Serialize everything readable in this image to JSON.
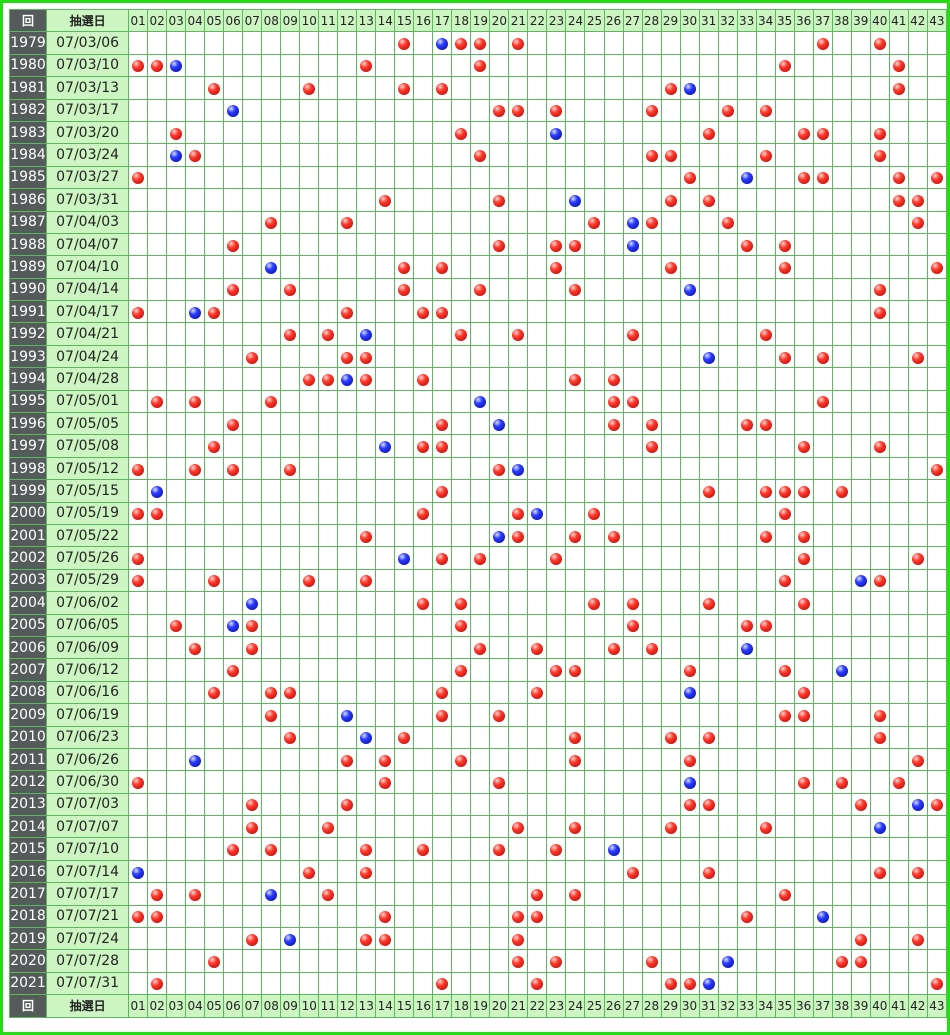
{
  "header": {
    "kai_label": "回",
    "date_label": "抽選日"
  },
  "footer": {
    "kai_label": "回",
    "date_label": "抽選日"
  },
  "numbers": [
    "01",
    "02",
    "03",
    "04",
    "05",
    "06",
    "07",
    "08",
    "09",
    "10",
    "11",
    "12",
    "13",
    "14",
    "15",
    "16",
    "17",
    "18",
    "19",
    "20",
    "21",
    "22",
    "23",
    "24",
    "25",
    "26",
    "27",
    "28",
    "29",
    "30",
    "31",
    "32",
    "33",
    "34",
    "35",
    "36",
    "37",
    "38",
    "39",
    "40",
    "41",
    "42",
    "43"
  ],
  "draws": [
    {
      "kai": "1979",
      "date": "07/03/06",
      "main": [
        15,
        18,
        19,
        21,
        37,
        40
      ],
      "bonus": 17
    },
    {
      "kai": "1980",
      "date": "07/03/10",
      "main": [
        1,
        2,
        13,
        19,
        35,
        41
      ],
      "bonus": 3
    },
    {
      "kai": "1981",
      "date": "07/03/13",
      "main": [
        5,
        10,
        15,
        17,
        29,
        41
      ],
      "bonus": 30
    },
    {
      "kai": "1982",
      "date": "07/03/17",
      "main": [
        20,
        21,
        23,
        28,
        32,
        34
      ],
      "bonus": 6
    },
    {
      "kai": "1983",
      "date": "07/03/20",
      "main": [
        3,
        18,
        31,
        36,
        37,
        40
      ],
      "bonus": 23
    },
    {
      "kai": "1984",
      "date": "07/03/24",
      "main": [
        4,
        19,
        28,
        29,
        34,
        40
      ],
      "bonus": 3
    },
    {
      "kai": "1985",
      "date": "07/03/27",
      "main": [
        1,
        30,
        36,
        37,
        41,
        43
      ],
      "bonus": 33
    },
    {
      "kai": "1986",
      "date": "07/03/31",
      "main": [
        14,
        20,
        29,
        31,
        41,
        42
      ],
      "bonus": 24
    },
    {
      "kai": "1987",
      "date": "07/04/03",
      "main": [
        8,
        12,
        25,
        28,
        32,
        42
      ],
      "bonus": 27
    },
    {
      "kai": "1988",
      "date": "07/04/07",
      "main": [
        6,
        20,
        23,
        24,
        33,
        35
      ],
      "bonus": 27
    },
    {
      "kai": "1989",
      "date": "07/04/10",
      "main": [
        15,
        17,
        23,
        29,
        35,
        43
      ],
      "bonus": 8
    },
    {
      "kai": "1990",
      "date": "07/04/14",
      "main": [
        6,
        9,
        15,
        19,
        24,
        40
      ],
      "bonus": 30
    },
    {
      "kai": "1991",
      "date": "07/04/17",
      "main": [
        1,
        5,
        12,
        16,
        17,
        40
      ],
      "bonus": 4
    },
    {
      "kai": "1992",
      "date": "07/04/21",
      "main": [
        9,
        11,
        18,
        21,
        27,
        34
      ],
      "bonus": 13
    },
    {
      "kai": "1993",
      "date": "07/04/24",
      "main": [
        7,
        12,
        13,
        35,
        37,
        42
      ],
      "bonus": 31
    },
    {
      "kai": "1994",
      "date": "07/04/28",
      "main": [
        10,
        11,
        13,
        16,
        24,
        26
      ],
      "bonus": 12
    },
    {
      "kai": "1995",
      "date": "07/05/01",
      "main": [
        2,
        4,
        8,
        26,
        27,
        37
      ],
      "bonus": 19
    },
    {
      "kai": "1996",
      "date": "07/05/05",
      "main": [
        6,
        17,
        26,
        28,
        33,
        34
      ],
      "bonus": 20
    },
    {
      "kai": "1997",
      "date": "07/05/08",
      "main": [
        5,
        16,
        17,
        28,
        36,
        40
      ],
      "bonus": 14
    },
    {
      "kai": "1998",
      "date": "07/05/12",
      "main": [
        1,
        4,
        6,
        9,
        20,
        43
      ],
      "bonus": 21
    },
    {
      "kai": "1999",
      "date": "07/05/15",
      "main": [
        17,
        31,
        34,
        35,
        36,
        38
      ],
      "bonus": 2
    },
    {
      "kai": "2000",
      "date": "07/05/19",
      "main": [
        1,
        2,
        16,
        21,
        25,
        35
      ],
      "bonus": 22
    },
    {
      "kai": "2001",
      "date": "07/05/22",
      "main": [
        13,
        21,
        24,
        26,
        34,
        36
      ],
      "bonus": 20
    },
    {
      "kai": "2002",
      "date": "07/05/26",
      "main": [
        1,
        17,
        19,
        23,
        36,
        42
      ],
      "bonus": 15
    },
    {
      "kai": "2003",
      "date": "07/05/29",
      "main": [
        1,
        5,
        10,
        13,
        35,
        40
      ],
      "bonus": 39
    },
    {
      "kai": "2004",
      "date": "07/06/02",
      "main": [
        16,
        18,
        25,
        27,
        31,
        36
      ],
      "bonus": 7
    },
    {
      "kai": "2005",
      "date": "07/06/05",
      "main": [
        3,
        7,
        18,
        27,
        33,
        34
      ],
      "bonus": 6
    },
    {
      "kai": "2006",
      "date": "07/06/09",
      "main": [
        4,
        7,
        19,
        22,
        26,
        28
      ],
      "bonus": 33
    },
    {
      "kai": "2007",
      "date": "07/06/12",
      "main": [
        6,
        18,
        23,
        24,
        30,
        35
      ],
      "bonus": 38
    },
    {
      "kai": "2008",
      "date": "07/06/16",
      "main": [
        5,
        8,
        9,
        17,
        22,
        36
      ],
      "bonus": 30
    },
    {
      "kai": "2009",
      "date": "07/06/19",
      "main": [
        8,
        17,
        20,
        35,
        36,
        40
      ],
      "bonus": 12
    },
    {
      "kai": "2010",
      "date": "07/06/23",
      "main": [
        9,
        15,
        24,
        29,
        31,
        40
      ],
      "bonus": 13
    },
    {
      "kai": "2011",
      "date": "07/06/26",
      "main": [
        12,
        14,
        18,
        24,
        30,
        42
      ],
      "bonus": 4
    },
    {
      "kai": "2012",
      "date": "07/06/30",
      "main": [
        1,
        14,
        20,
        36,
        38,
        41
      ],
      "bonus": 30
    },
    {
      "kai": "2013",
      "date": "07/07/03",
      "main": [
        7,
        12,
        30,
        31,
        39,
        43
      ],
      "bonus": 42
    },
    {
      "kai": "2014",
      "date": "07/07/07",
      "main": [
        7,
        11,
        21,
        24,
        29,
        34
      ],
      "bonus": 40
    },
    {
      "kai": "2015",
      "date": "07/07/10",
      "main": [
        6,
        8,
        13,
        16,
        20,
        23
      ],
      "bonus": 26
    },
    {
      "kai": "2016",
      "date": "07/07/14",
      "main": [
        10,
        13,
        27,
        31,
        40,
        42
      ],
      "bonus": 1
    },
    {
      "kai": "2017",
      "date": "07/07/17",
      "main": [
        2,
        4,
        11,
        22,
        24,
        35
      ],
      "bonus": 8
    },
    {
      "kai": "2018",
      "date": "07/07/21",
      "main": [
        1,
        2,
        14,
        21,
        22,
        33
      ],
      "bonus": 37
    },
    {
      "kai": "2019",
      "date": "07/07/24",
      "main": [
        7,
        13,
        14,
        21,
        39,
        42
      ],
      "bonus": 9
    },
    {
      "kai": "2020",
      "date": "07/07/28",
      "main": [
        5,
        21,
        23,
        28,
        38,
        39
      ],
      "bonus": 32
    },
    {
      "kai": "2021",
      "date": "07/07/31",
      "main": [
        2,
        17,
        22,
        29,
        30,
        43
      ],
      "bonus": 31
    }
  ],
  "colors": {
    "main": "#e8281e",
    "bonus": "#1f2fe0",
    "frame": "#22dd11",
    "grid": "#5cb85c",
    "kai_bg": "#555b5b",
    "date_bg": "#ccf5c2"
  }
}
